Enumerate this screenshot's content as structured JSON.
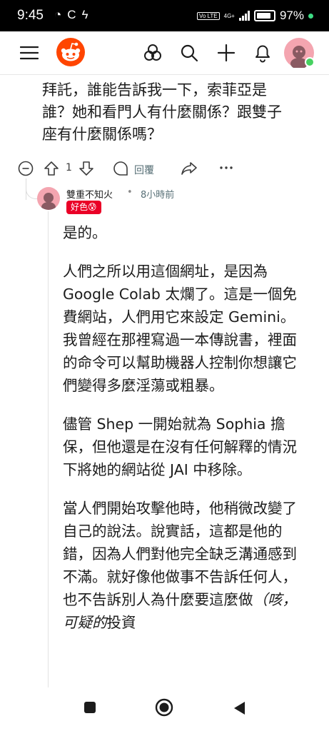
{
  "status": {
    "time": "9:45",
    "left_icons": [
      "refresh-icon",
      "c-icon",
      "bolt-icon"
    ],
    "volte": "Vo LTE",
    "network": "4G+",
    "battery": "97%"
  },
  "header": {
    "icons": [
      "menu-icon",
      "reddit-logo",
      "communities-icon",
      "search-icon",
      "plus-icon",
      "bell-icon",
      "avatar"
    ]
  },
  "post": {
    "text": "拜託，誰能告訴我一下，索菲亞是誰？她和看門人有什麼關係？跟雙子座有什麼關係嗎？",
    "vote_count": "1",
    "reply_label": "回覆"
  },
  "comment": {
    "username": "雙重不知火",
    "separator": "•",
    "time": "8小時前",
    "flair": "好色😰",
    "paragraphs": [
      "是的。",
      "人們之所以用這個網址，是因為 Google Colab 太爛了。這是一個免費網站，人們用它來設定 Gemini。我曾經在那裡寫過一本傳說書，裡面的命令可以幫助機器人控制你想讓它們變得多麼淫蕩或粗暴。",
      "儘管 Shep 一開始就為 Sophia 擔保，但他還是在沒有任何解釋的情況下將她的網站從 JAI 中移除。"
    ],
    "last_paragraph_main": "當人們開始攻擊他時，他稍微改變了自己的說法。說實話，這都是他的錯，因為人們對他完全缺乏溝通感到不滿。就好像他做事不告訴任何人，也不告訴別人為什麼要這麼做",
    "last_paragraph_italic": "（咳，可疑的",
    "last_paragraph_tail": "投資"
  },
  "navbar": {
    "buttons": [
      "recents-button",
      "home-button",
      "back-button"
    ]
  },
  "colors": {
    "brand": "#ff4500",
    "flair_bg": "#ea0027",
    "meta_gray": "#576f76"
  }
}
